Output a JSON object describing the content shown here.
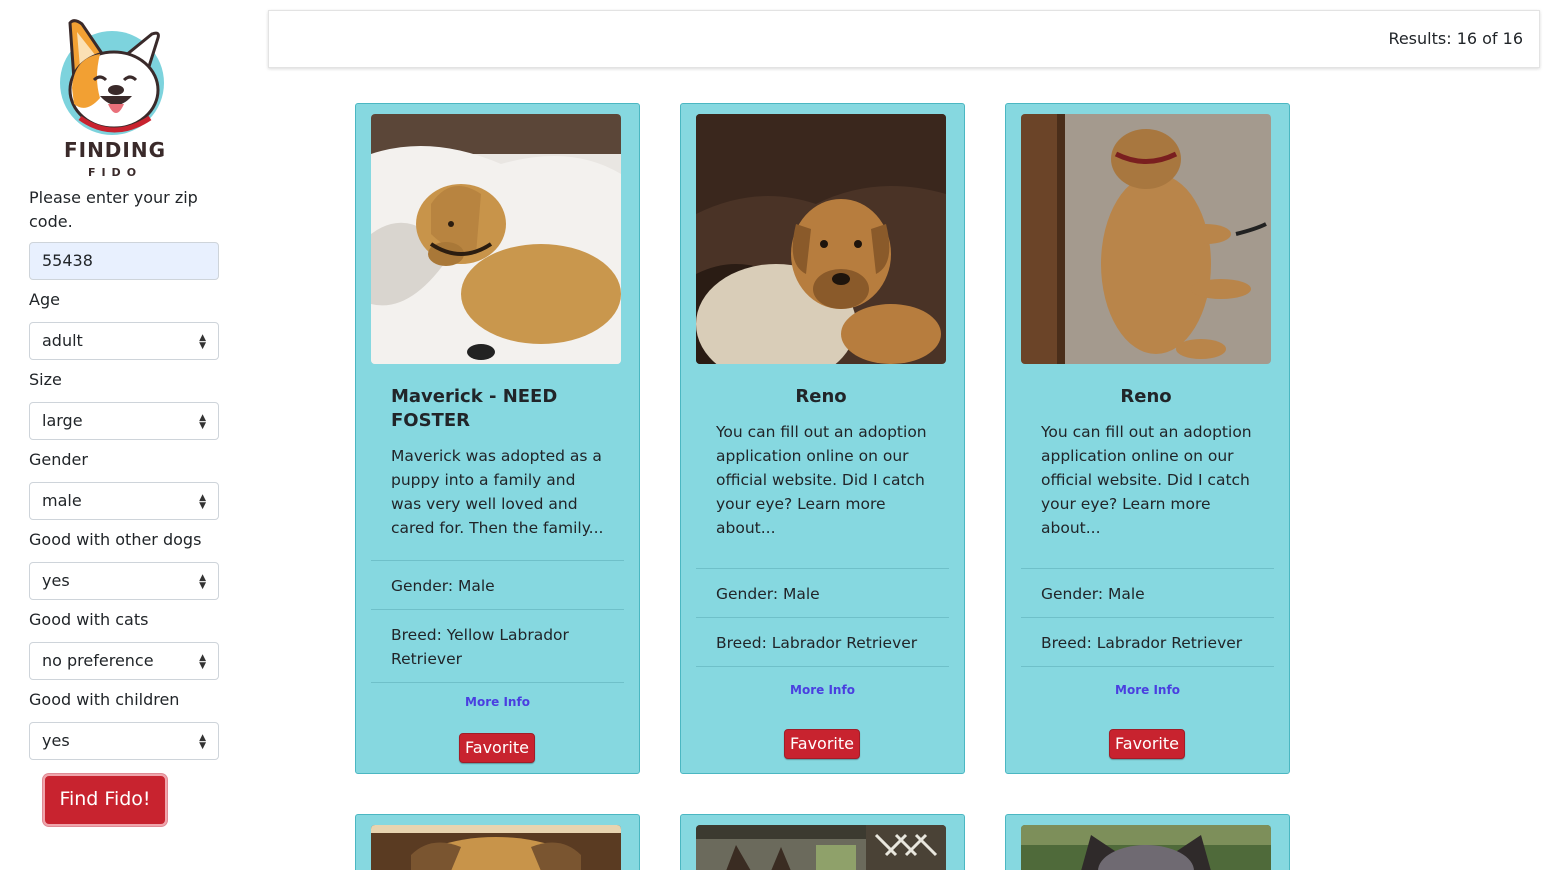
{
  "logo": {
    "line1": "FINDING",
    "line2": "FIDO"
  },
  "form": {
    "zip_label": "Please enter your zip code.",
    "zip_value": "55438",
    "fields": [
      {
        "label": "Age",
        "value": "adult"
      },
      {
        "label": "Size",
        "value": "large"
      },
      {
        "label": "Gender",
        "value": "male"
      },
      {
        "label": "Good with other dogs",
        "value": "yes"
      },
      {
        "label": "Good with cats",
        "value": "no preference"
      },
      {
        "label": "Good with children",
        "value": "yes"
      }
    ],
    "submit_label": "Find Fido!"
  },
  "results": {
    "text": "Results: 16 of 16"
  },
  "cards": [
    {
      "name": "Maverick - NEED FOSTER",
      "description": "Maverick was adopted as a puppy into a family and was very well loved and cared for. Then the family...",
      "gender": "Gender: Male",
      "breed": "Breed: Yellow Labrador Retriever",
      "more_info": "More Info",
      "favorite": "Favorite"
    },
    {
      "name": "Reno",
      "description": "You can fill out an adoption application online on our official website. Did I catch your eye? Learn more about...",
      "gender": "Gender: Male",
      "breed": "Breed: Labrador Retriever",
      "more_info": "More Info",
      "favorite": "Favorite"
    },
    {
      "name": "Reno",
      "description": "You can fill out an adoption application online on our official website. Did I catch your eye? Learn more about...",
      "gender": "Gender: Male",
      "breed": "Breed: Labrador Retriever",
      "more_info": "More Info",
      "favorite": "Favorite"
    }
  ],
  "colors": {
    "card_bg": "#86d8e0",
    "button_red": "#c8232f",
    "link_blue": "#4a3fe0"
  }
}
